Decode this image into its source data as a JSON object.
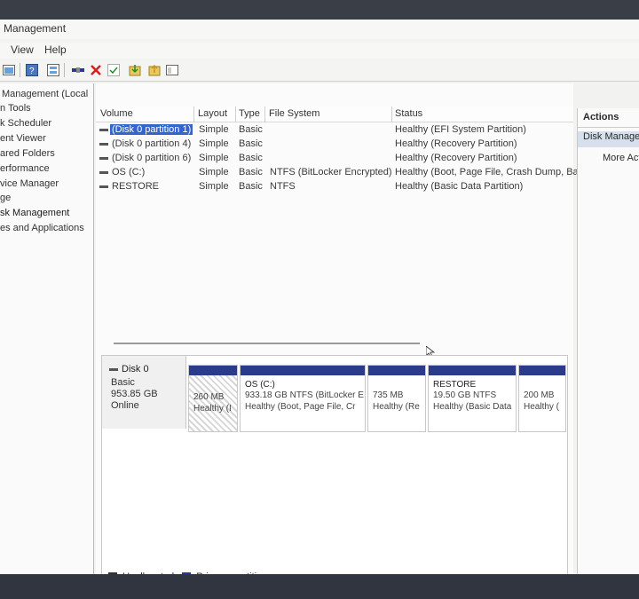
{
  "window": {
    "title": "Management"
  },
  "menu": [
    "View",
    "Help"
  ],
  "toolbar": {
    "icons": [
      "console-icon",
      "help-icon",
      "properties-icon",
      "connect-icon",
      "delete-icon",
      "check-icon",
      "import-icon",
      "export-icon",
      "view-icon"
    ]
  },
  "tree": [
    "Management (Local",
    "n Tools",
    "k Scheduler",
    "ent Viewer",
    "ared Folders",
    "erformance",
    "vice Manager",
    "ge",
    "sk Management",
    "es and Applications"
  ],
  "volumes": {
    "columns": [
      "Volume",
      "Layout",
      "Type",
      "File System",
      "Status"
    ],
    "rows": [
      {
        "name": "(Disk 0 partition 1)",
        "layout": "Simple",
        "type": "Basic",
        "fs": "",
        "status": "Healthy (EFI System Partition)"
      },
      {
        "name": "(Disk 0 partition 4)",
        "layout": "Simple",
        "type": "Basic",
        "fs": "",
        "status": "Healthy (Recovery Partition)"
      },
      {
        "name": "(Disk 0 partition 6)",
        "layout": "Simple",
        "type": "Basic",
        "fs": "",
        "status": "Healthy (Recovery Partition)"
      },
      {
        "name": "OS (C:)",
        "layout": "Simple",
        "type": "Basic",
        "fs": "NTFS (BitLocker Encrypted)",
        "status": "Healthy (Boot, Page File, Crash Dump, Basi"
      },
      {
        "name": "RESTORE",
        "layout": "Simple",
        "type": "Basic",
        "fs": "NTFS",
        "status": "Healthy (Basic Data Partition)"
      }
    ]
  },
  "disk": {
    "name": "Disk 0",
    "type": "Basic",
    "size": "953.85 GB",
    "state": "Online",
    "partitions": [
      {
        "label": "",
        "size": "260 MB",
        "status": "Healthy (I"
      },
      {
        "label": "OS (C:)",
        "size": "933.18 GB NTFS (BitLocker E",
        "status": "Healthy (Boot, Page File, Cr"
      },
      {
        "label": "",
        "size": "735 MB",
        "status": "Healthy (Re"
      },
      {
        "label": "RESTORE",
        "size": "19.50 GB NTFS",
        "status": "Healthy (Basic Data"
      },
      {
        "label": "",
        "size": "200 MB",
        "status": "Healthy ("
      }
    ]
  },
  "legend": [
    {
      "label": "Unallocated",
      "color": "#333333"
    },
    {
      "label": "Primary partition",
      "color": "#2c3a8a"
    }
  ],
  "actions": {
    "title": "Actions",
    "section": "Disk Managem",
    "more": "More Act"
  }
}
